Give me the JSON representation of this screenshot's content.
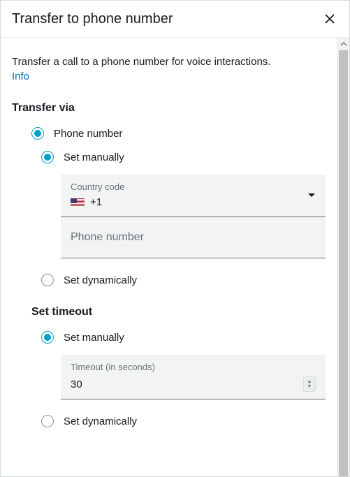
{
  "dialog": {
    "title": "Transfer to phone number",
    "description": "Transfer a call to a phone number for voice interactions.",
    "info_label": "Info"
  },
  "transfer_via": {
    "heading": "Transfer via",
    "option_phone": "Phone number",
    "option_set_manually": "Set manually",
    "option_set_dynamically": "Set dynamically",
    "country_code_label": "Country code",
    "country_code_value": "+1",
    "phone_placeholder": "Phone number"
  },
  "timeout": {
    "heading": "Set timeout",
    "option_set_manually": "Set manually",
    "option_set_dynamically": "Set dynamically",
    "timeout_label": "Timeout (in seconds)",
    "timeout_value": "30"
  }
}
